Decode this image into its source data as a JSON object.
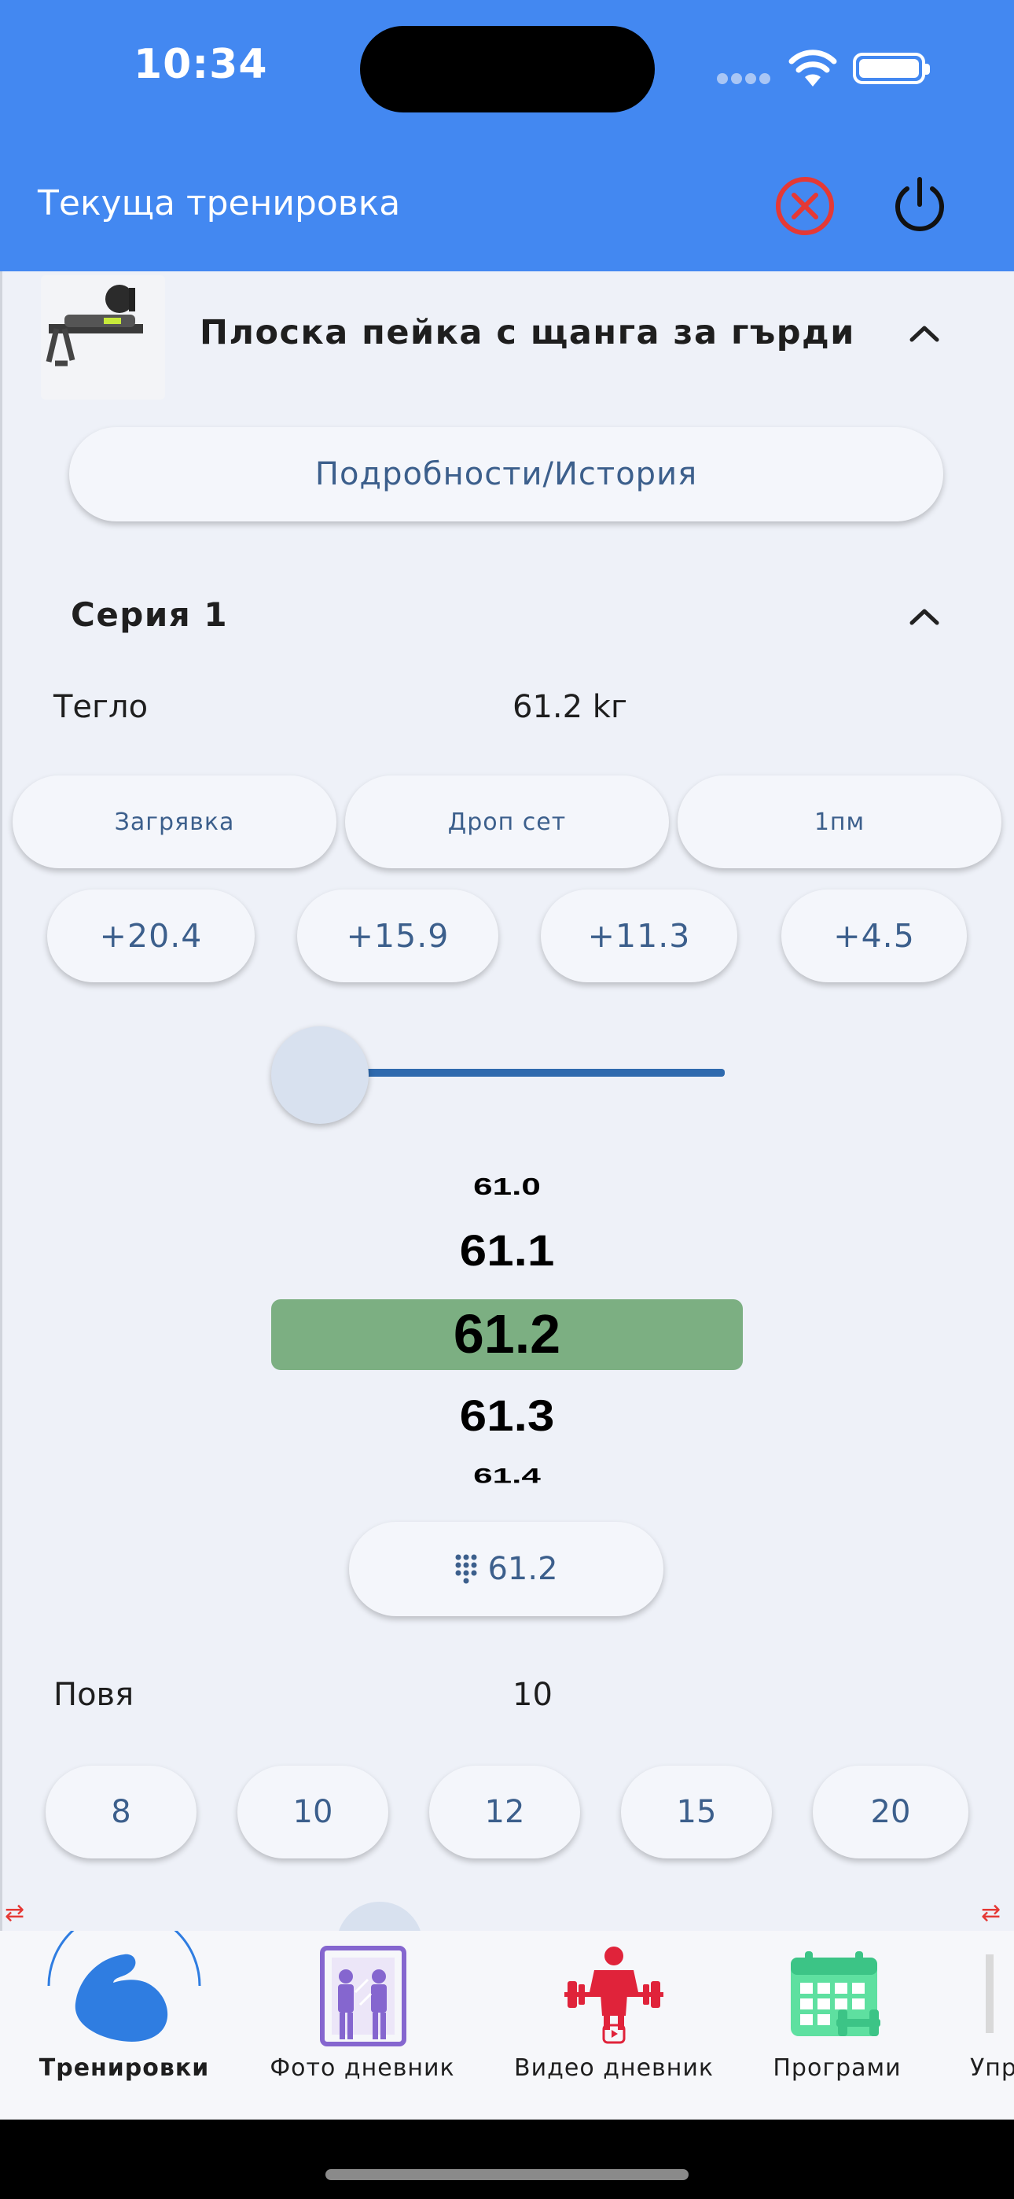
{
  "status": {
    "time": "10:34"
  },
  "appbar": {
    "title": "Текуща тренировка"
  },
  "exercise": {
    "title": "Плоска пейка с щанга за гърди",
    "details_label": "Подробности/История"
  },
  "series": {
    "title": "Серия 1",
    "weight_label": "Тегло",
    "weight_value": "61.2 kг",
    "modes": [
      "Загрявка",
      "Дроп сет",
      "1пм"
    ],
    "increments": [
      "+20.4",
      "+15.9",
      "+11.3",
      "+4.5"
    ],
    "slider_fraction": 0.0,
    "picker": [
      "61.0",
      "61.1",
      "61.2",
      "61.3",
      "61.4"
    ],
    "numpad_value": "61.2",
    "reps_label": "Повя",
    "reps_value": "10",
    "reps_options": [
      "8",
      "10",
      "12",
      "15",
      "20"
    ]
  },
  "nav": {
    "items": [
      {
        "label": "Тренировки",
        "active": true
      },
      {
        "label": "Фото дневник"
      },
      {
        "label": "Видео дневник"
      },
      {
        "label": "Програми"
      },
      {
        "label": "Упр"
      }
    ]
  },
  "colors": {
    "appbar": "#4388f1",
    "picker_selected": "#7caf82",
    "close_icon": "#e53935",
    "accent_text": "#3c5f8c"
  }
}
